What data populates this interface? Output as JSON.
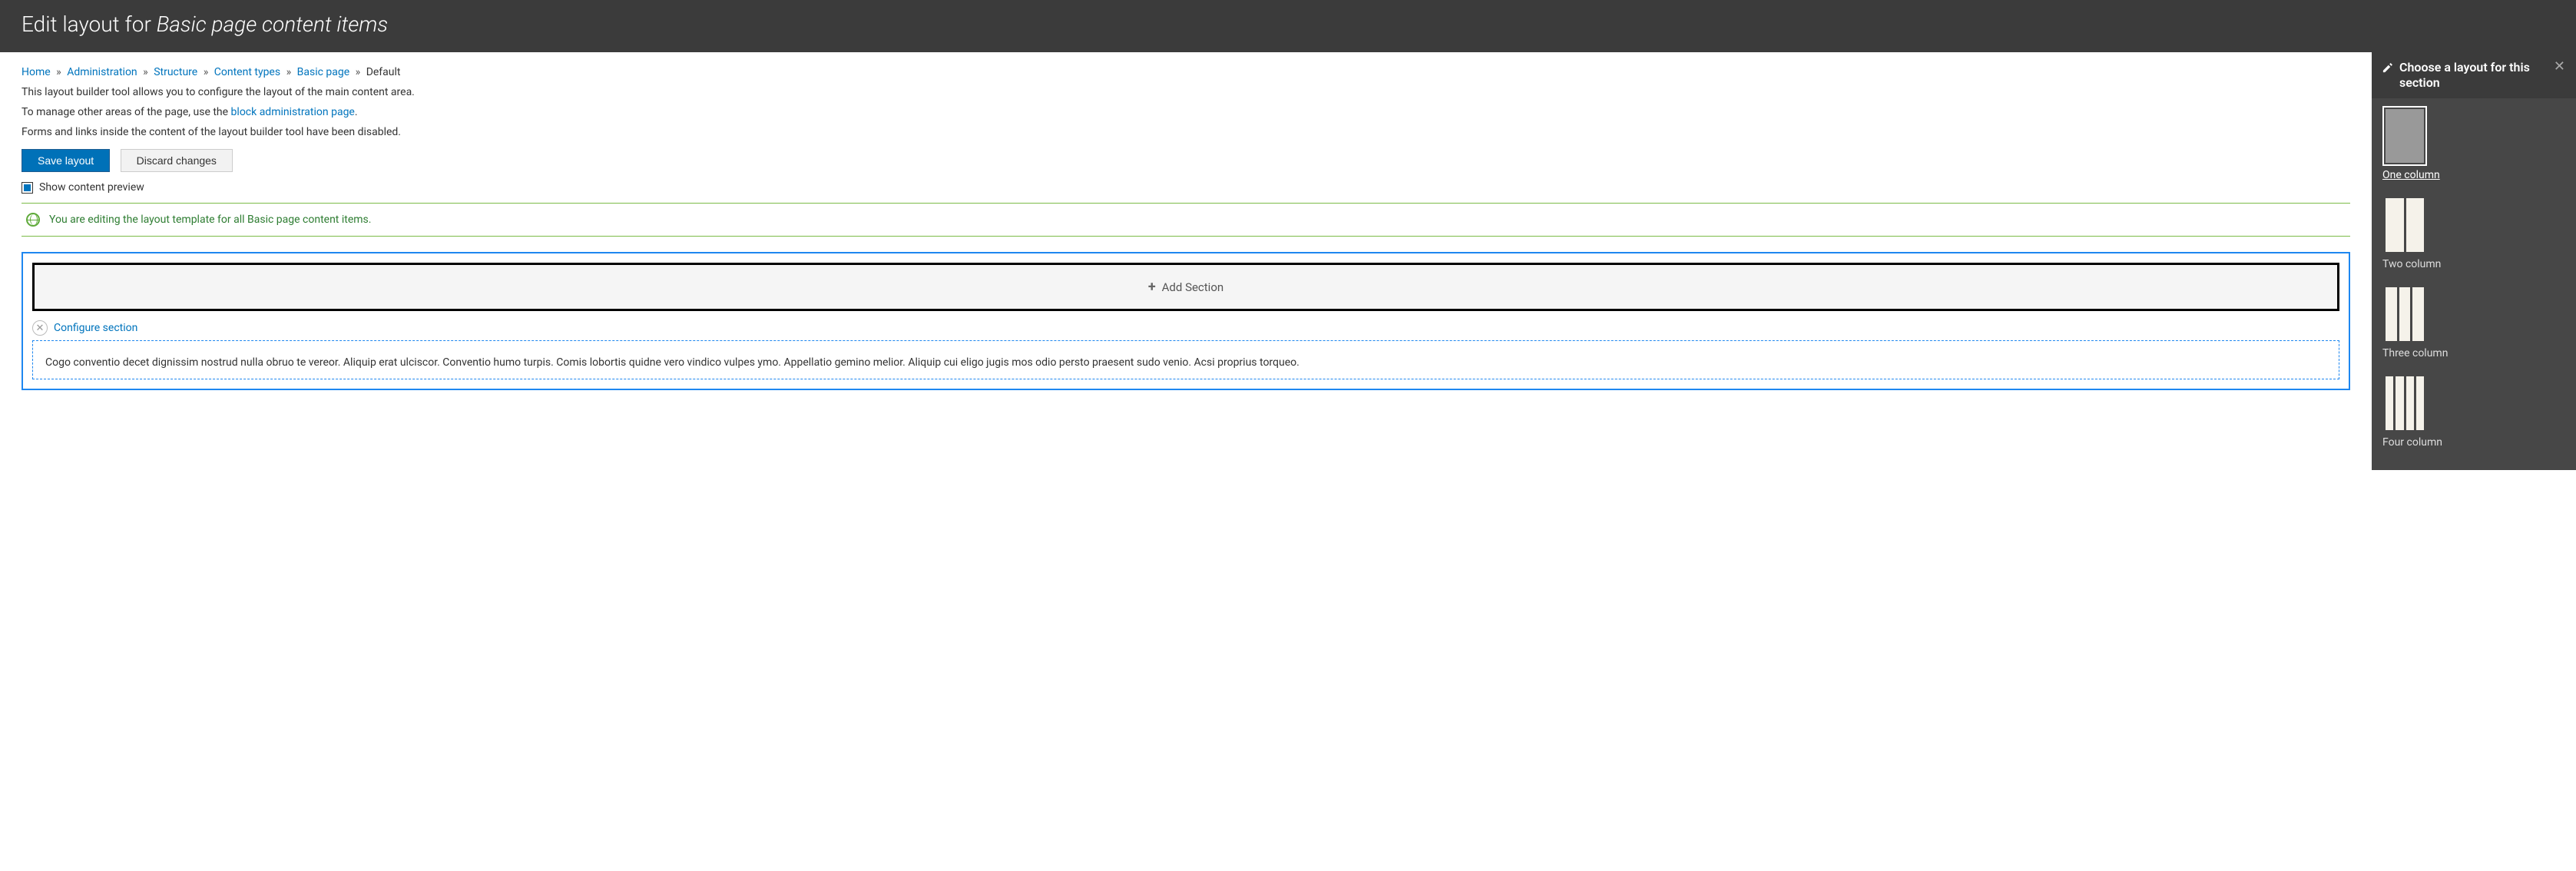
{
  "header": {
    "title_prefix": "Edit layout for ",
    "title_italic": "Basic page content items"
  },
  "breadcrumbs": {
    "items": [
      "Home",
      "Administration",
      "Structure",
      "Content types",
      "Basic page",
      "Default"
    ]
  },
  "intro": {
    "line1": "This layout builder tool allows you to configure the layout of the main content area.",
    "line2_pre": "To manage other areas of the page, use the ",
    "line2_link": "block administration page",
    "line2_post": ".",
    "line3": "Forms and links inside the content of the layout builder tool have been disabled."
  },
  "actions": {
    "save": "Save layout",
    "discard": "Discard changes"
  },
  "preview_checkbox": {
    "label": "Show content preview",
    "checked": true
  },
  "status": {
    "message": "You are editing the layout template for all Basic page content items."
  },
  "add_section_label": "Add Section",
  "configure_section_label": "Configure section",
  "sample_block_text": "Cogo conventio decet dignissim nostrud nulla obruo te vereor. Aliquip erat ulciscor. Conventio humo turpis. Comis lobortis quidne vero vindico vulpes ymo. Appellatio gemino melior. Aliquip cui eligo jugis mos odio persto praesent sudo venio. Acsi proprius torqueo.",
  "sidebar": {
    "title": "Choose a layout for this section",
    "options": [
      {
        "label": "One column",
        "cols": 1,
        "selected": true
      },
      {
        "label": "Two column",
        "cols": 2,
        "selected": false
      },
      {
        "label": "Three column",
        "cols": 3,
        "selected": false
      },
      {
        "label": "Four column",
        "cols": 4,
        "selected": false
      }
    ]
  }
}
